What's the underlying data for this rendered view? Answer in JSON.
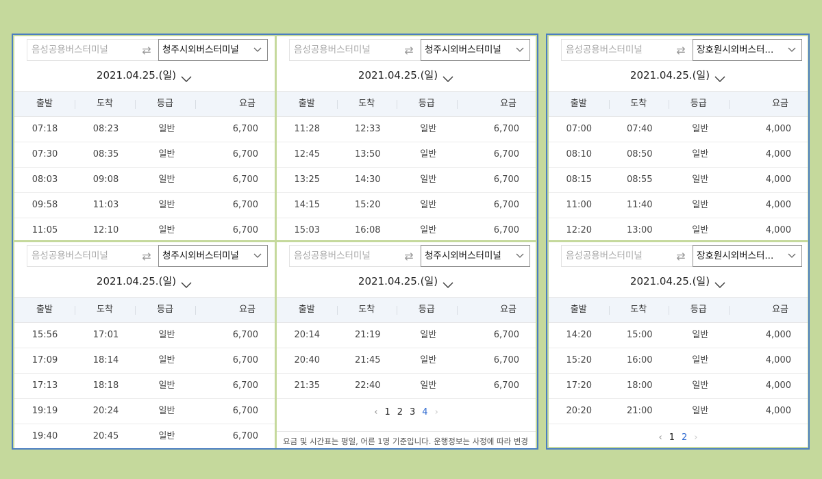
{
  "colors": {
    "background": "#c5d99c",
    "frame_border": "#4a7ec2",
    "header_bg": "#f1f5fa",
    "active_page": "#2f6ad0"
  },
  "panels": [
    {
      "origin_placeholder": "음성공용버스터미널",
      "destination": "청주시외버스터미널",
      "date": "2021.04.25.(일)",
      "headers": [
        "출발",
        "도착",
        "등급",
        "요금"
      ],
      "rows": [
        [
          "07:18",
          "08:23",
          "일반",
          "6,700"
        ],
        [
          "07:30",
          "08:35",
          "일반",
          "6,700"
        ],
        [
          "08:03",
          "09:08",
          "일반",
          "6,700"
        ],
        [
          "09:58",
          "11:03",
          "일반",
          "6,700"
        ],
        [
          "11:05",
          "12:10",
          "일반",
          "6,700"
        ]
      ]
    },
    {
      "origin_placeholder": "음성공용버스터미널",
      "destination": "청주시외버스터미널",
      "date": "2021.04.25.(일)",
      "headers": [
        "출발",
        "도착",
        "등급",
        "요금"
      ],
      "rows": [
        [
          "11:28",
          "12:33",
          "일반",
          "6,700"
        ],
        [
          "12:45",
          "13:50",
          "일반",
          "6,700"
        ],
        [
          "13:25",
          "14:30",
          "일반",
          "6,700"
        ],
        [
          "14:15",
          "15:20",
          "일반",
          "6,700"
        ],
        [
          "15:03",
          "16:08",
          "일반",
          "6,700"
        ]
      ]
    },
    {
      "origin_placeholder": "음성공용버스터미널",
      "destination": "장호원시외버스터...",
      "date": "2021.04.25.(일)",
      "headers": [
        "출발",
        "도착",
        "등급",
        "요금"
      ],
      "rows": [
        [
          "07:00",
          "07:40",
          "일반",
          "4,000"
        ],
        [
          "08:10",
          "08:50",
          "일반",
          "4,000"
        ],
        [
          "08:15",
          "08:55",
          "일반",
          "4,000"
        ],
        [
          "11:00",
          "11:40",
          "일반",
          "4,000"
        ],
        [
          "12:20",
          "13:00",
          "일반",
          "4,000"
        ]
      ]
    },
    {
      "origin_placeholder": "음성공용버스터미널",
      "destination": "청주시외버스터미널",
      "date": "2021.04.25.(일)",
      "headers": [
        "출발",
        "도착",
        "등급",
        "요금"
      ],
      "rows": [
        [
          "15:56",
          "17:01",
          "일반",
          "6,700"
        ],
        [
          "17:09",
          "18:14",
          "일반",
          "6,700"
        ],
        [
          "17:13",
          "18:18",
          "일반",
          "6,700"
        ],
        [
          "19:19",
          "20:24",
          "일반",
          "6,700"
        ],
        [
          "19:40",
          "20:45",
          "일반",
          "6,700"
        ]
      ]
    },
    {
      "origin_placeholder": "음성공용버스터미널",
      "destination": "청주시외버스터미널",
      "date": "2021.04.25.(일)",
      "headers": [
        "출발",
        "도착",
        "등급",
        "요금"
      ],
      "rows": [
        [
          "20:14",
          "21:19",
          "일반",
          "6,700"
        ],
        [
          "20:40",
          "21:45",
          "일반",
          "6,700"
        ],
        [
          "21:35",
          "22:40",
          "일반",
          "6,700"
        ]
      ],
      "pagination": {
        "prev": "‹",
        "pages": [
          "1",
          "2",
          "3",
          "4"
        ],
        "current": "4",
        "next": "›"
      },
      "note": "요금 및 시간표는 평일, 어른 1명 기준입니다. 운행정보는 사정에 따라 변경"
    },
    {
      "origin_placeholder": "음성공용버스터미널",
      "destination": "장호원시외버스터...",
      "date": "2021.04.25.(일)",
      "headers": [
        "출발",
        "도착",
        "등급",
        "요금"
      ],
      "rows": [
        [
          "14:20",
          "15:00",
          "일반",
          "4,000"
        ],
        [
          "15:20",
          "16:00",
          "일반",
          "4,000"
        ],
        [
          "17:20",
          "18:00",
          "일반",
          "4,000"
        ],
        [
          "20:20",
          "21:00",
          "일반",
          "4,000"
        ]
      ],
      "pagination": {
        "prev": "‹",
        "pages": [
          "1",
          "2"
        ],
        "current": "2",
        "next": "›"
      }
    }
  ]
}
